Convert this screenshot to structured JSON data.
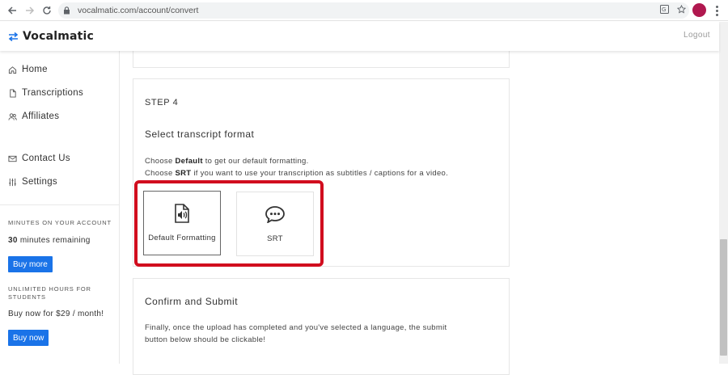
{
  "browser": {
    "url": "vocalmatic.com/account/convert"
  },
  "header": {
    "brand": "Vocalmatic",
    "logout": "Logout"
  },
  "sidebar": {
    "nav": [
      {
        "label": "Home",
        "icon": "home-icon"
      },
      {
        "label": "Transcriptions",
        "icon": "file-icon"
      },
      {
        "label": "Affiliates",
        "icon": "users-icon"
      },
      {
        "label": "Contact Us",
        "icon": "mail-icon"
      },
      {
        "label": "Settings",
        "icon": "sliders-icon"
      }
    ],
    "minutes_caption": "MINUTES ON YOUR ACCOUNT",
    "minutes_count": "30",
    "minutes_suffix": " minutes remaining",
    "buy_more": "Buy more",
    "students_caption": "UNLIMITED HOURS FOR STUDENTS",
    "students_offer": "Buy now for $29 / month!",
    "buy_now": "Buy now"
  },
  "step4": {
    "step_label": "STEP 4",
    "title": "Select transcript format",
    "line1_pre": "Choose ",
    "line1_bold": "Default",
    "line1_post": " to get our default formatting.",
    "line2_pre": "Choose ",
    "line2_bold": "SRT",
    "line2_post": " if you want to use your transcription as subtitles / captions for a video.",
    "options": [
      {
        "label": "Default Formatting",
        "icon": "audio-file-icon",
        "selected": true
      },
      {
        "label": "SRT",
        "icon": "chat-bubble-icon",
        "selected": false
      }
    ]
  },
  "confirm": {
    "title": "Confirm and Submit",
    "desc_line1": "Finally, once the upload has completed and you've selected a language, the submit",
    "desc_line2": "button below should be clickable!"
  },
  "colors": {
    "accent_blue": "#1a73e8",
    "highlight_red": "#d10d1e",
    "avatar": "#b0184f",
    "brand_icon": "#1a73e8"
  }
}
